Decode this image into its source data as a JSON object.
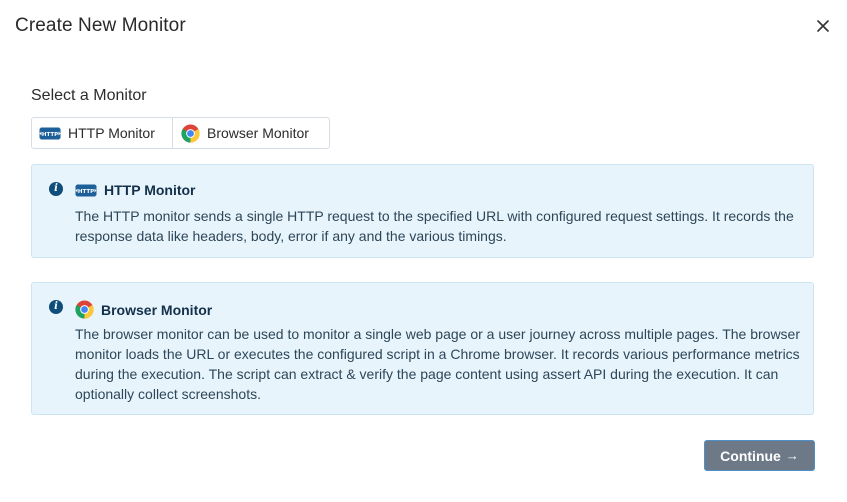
{
  "dialog": {
    "title": "Create New Monitor",
    "close_icon": "close-icon"
  },
  "selector": {
    "label": "Select a Monitor",
    "options": [
      {
        "label": "HTTP Monitor",
        "icon": "http-icon"
      },
      {
        "label": "Browser Monitor",
        "icon": "chrome-icon"
      }
    ]
  },
  "cards": {
    "http": {
      "title": "HTTP Monitor",
      "icon": "http-icon",
      "description": "The HTTP monitor sends a single HTTP request to the specified URL with configured request settings. It records the response data like headers, body, error if any and the various timings."
    },
    "browser": {
      "title": "Browser Monitor",
      "icon": "chrome-icon",
      "description": "The browser monitor can be used to monitor a single web page or a user journey across multiple pages. The browser monitor loads the URL or executes the configured script in a Chrome browser. It records various performance metrics during the execution. The script can extract & verify the page content using assert API during the execution. It can optionally collect screenshots."
    }
  },
  "footer": {
    "continue_label": "Continue",
    "continue_arrow": "→"
  },
  "colors": {
    "card_background": "#e7f4fc",
    "info_icon": "#0f4d7a",
    "continue_button": "#6e7987"
  }
}
